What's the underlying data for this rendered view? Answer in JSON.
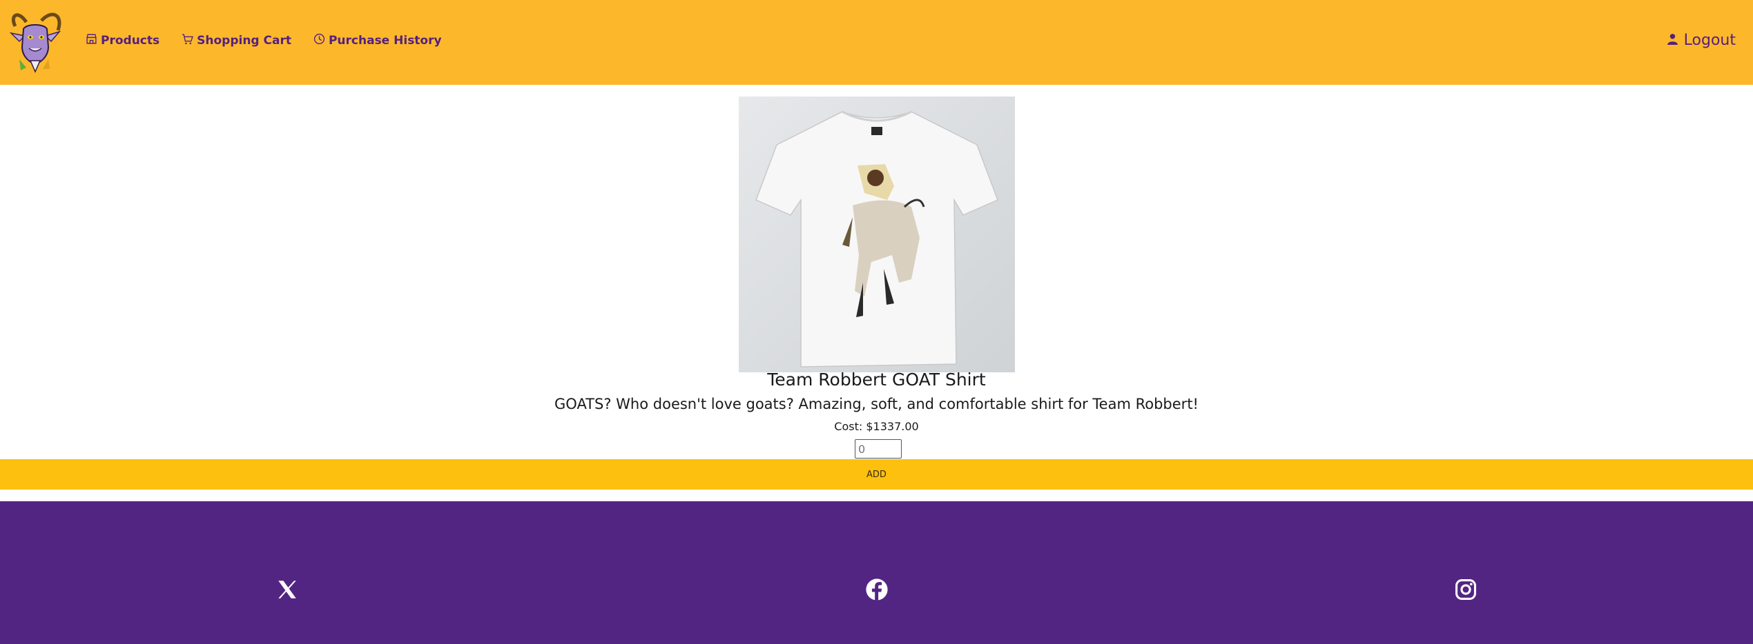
{
  "header": {
    "logo_alt": "goat-logo",
    "nav": [
      {
        "label": "Products",
        "icon": "store-icon"
      },
      {
        "label": "Shopping Cart",
        "icon": "cart-icon"
      },
      {
        "label": "Purchase History",
        "icon": "clock-icon"
      }
    ],
    "logout_label": "Logout",
    "logout_icon": "user-icon"
  },
  "product": {
    "image": "tshirt-with-man-riding-goat",
    "title": "Team Robbert GOAT Shirt",
    "description": "GOATS? Who doesn't love goats? Amazing, soft, and comfortable shirt for Team Robbert!",
    "cost": "Cost: $1337.00",
    "quantity_placeholder": "0",
    "add_label": "ADD"
  },
  "footer": {
    "social": [
      "x-icon",
      "facebook-icon",
      "instagram-icon"
    ]
  },
  "colors": {
    "header": "#fcb82a",
    "add_button": "#fdc00f",
    "footer": "#532583",
    "nav_text": "#55207f"
  }
}
